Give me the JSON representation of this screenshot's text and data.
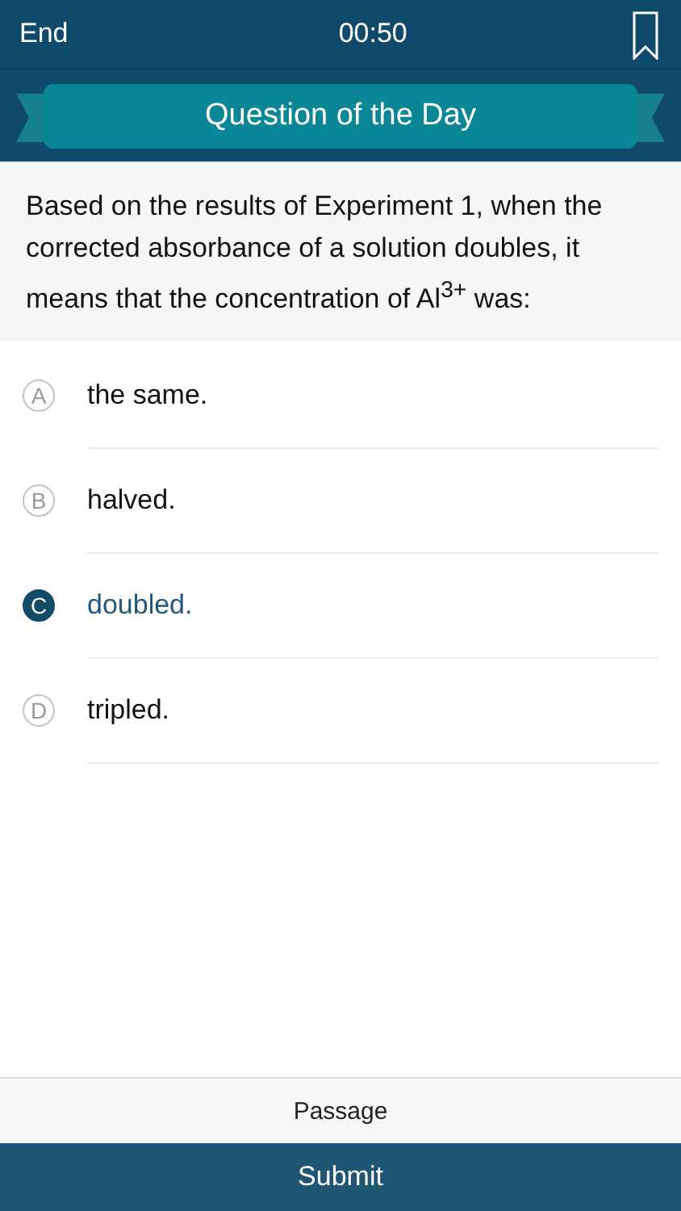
{
  "top_bar": {
    "end": "End",
    "timer": "00:50",
    "bookmarked": false
  },
  "banner": {
    "title": "Question of the Day"
  },
  "question": "Based on the results of Experiment 1, when the corrected absorbance of a solution doubles, it means that the concentration of Al$^{3+}$ was:",
  "options": [
    {
      "letter": "A",
      "text": "the same.",
      "selected": false
    },
    {
      "letter": "B",
      "text": "halved.",
      "selected": false
    },
    {
      "letter": "C",
      "text": "doubled.",
      "selected": true
    },
    {
      "letter": "D",
      "text": "tripled.",
      "selected": false
    }
  ],
  "footer": {
    "passage": "Passage",
    "submit": "Submit"
  }
}
